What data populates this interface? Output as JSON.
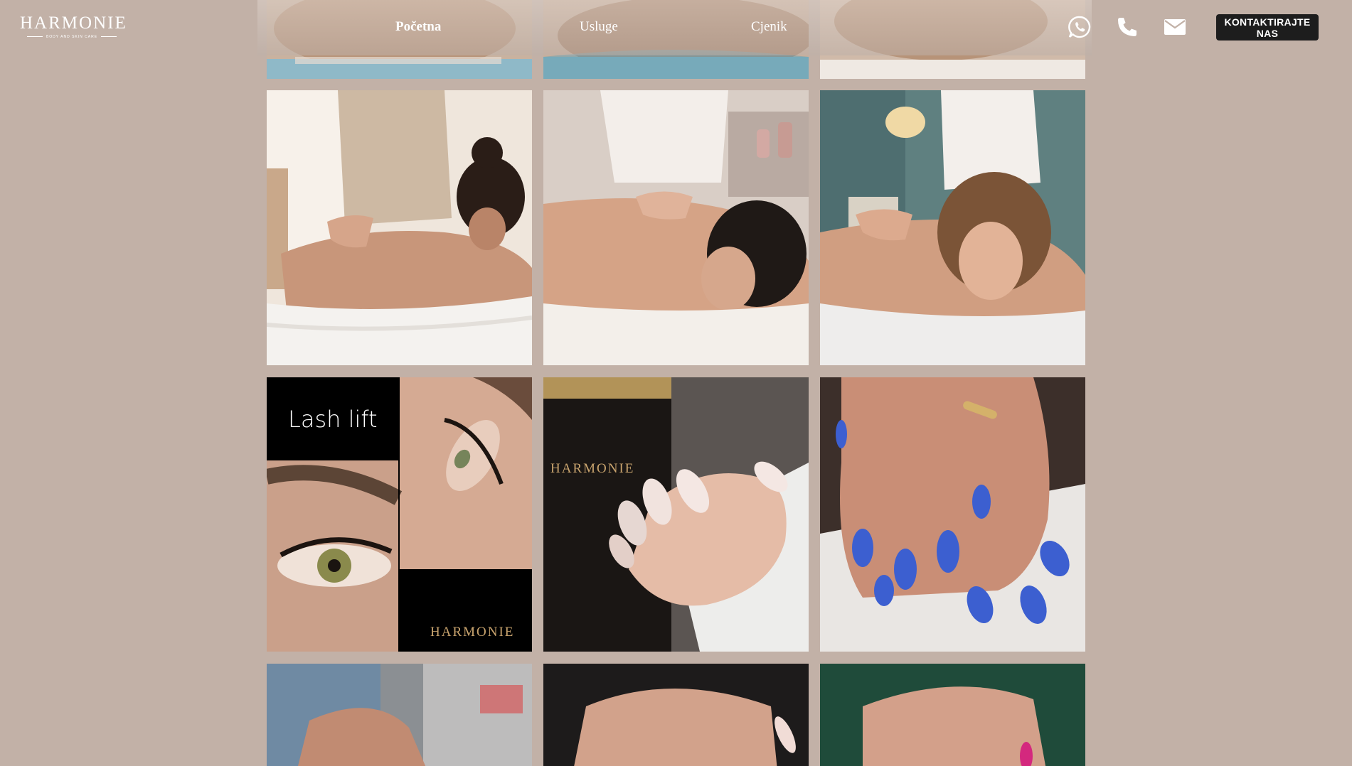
{
  "brand": {
    "name": "HARMONIE",
    "tagline": "BODY AND SKIN CARE"
  },
  "nav": {
    "items": [
      {
        "label": "Početna",
        "active": true
      },
      {
        "label": "Usluge",
        "active": false
      },
      {
        "label": "Cjenik",
        "active": false
      }
    ]
  },
  "contact_icons": [
    "whatsapp-icon",
    "phone-icon",
    "mail-icon"
  ],
  "cta": {
    "label": "KONTAKTIRAJTE NAS"
  },
  "gallery": {
    "lash_lift_title": "Lash lift",
    "lash_brand": "HARMONIE",
    "jar_brand": "HARMONIE",
    "tiles": [
      "massage-photo-top-1",
      "massage-photo-top-2",
      "massage-photo-top-3",
      "back-massage-photo-1",
      "back-massage-photo-2",
      "back-massage-photo-3",
      "lash-lift-collage",
      "french-nails-photo",
      "blue-nails-photo",
      "manicure-photo-1",
      "manicure-photo-2",
      "manicure-photo-3"
    ]
  },
  "colors": {
    "background": "#c2b1a7",
    "cta_background": "#1d1d1d",
    "text_light": "#ffffff",
    "nail_blue": "#3c5fd0"
  }
}
